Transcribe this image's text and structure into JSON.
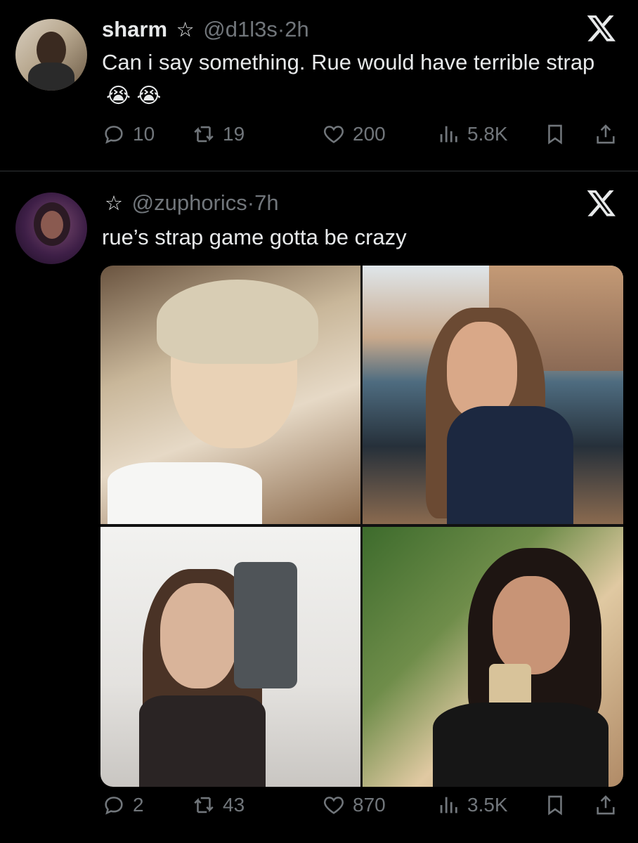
{
  "tweets": [
    {
      "display_name": "sharm",
      "star": "☆",
      "handle": "@d1l3s",
      "separator": "·",
      "time": "2h",
      "text": "Can i say something. Rue would have terrible strap",
      "emojis": "😭 😭",
      "metrics": {
        "replies": "10",
        "reposts": "19",
        "likes": "200",
        "views": "5.8K"
      }
    },
    {
      "display_name": "",
      "star": "☆",
      "handle": "@zuphorics",
      "separator": "·",
      "time": "7h",
      "text": "rue’s strap game gotta be crazy",
      "metrics": {
        "replies": "2",
        "reposts": "43",
        "likes": "870",
        "views": "3.5K"
      }
    }
  ],
  "icons": {
    "x_logo": "x-logo-icon",
    "reply": "reply-icon",
    "repost": "repost-icon",
    "like": "heart-icon",
    "views": "views-icon",
    "bookmark": "bookmark-icon",
    "share": "share-icon"
  },
  "colors": {
    "background": "#000000",
    "primary_text": "#e7e9ea",
    "secondary_text": "#71767b",
    "divider": "#2f3336"
  }
}
